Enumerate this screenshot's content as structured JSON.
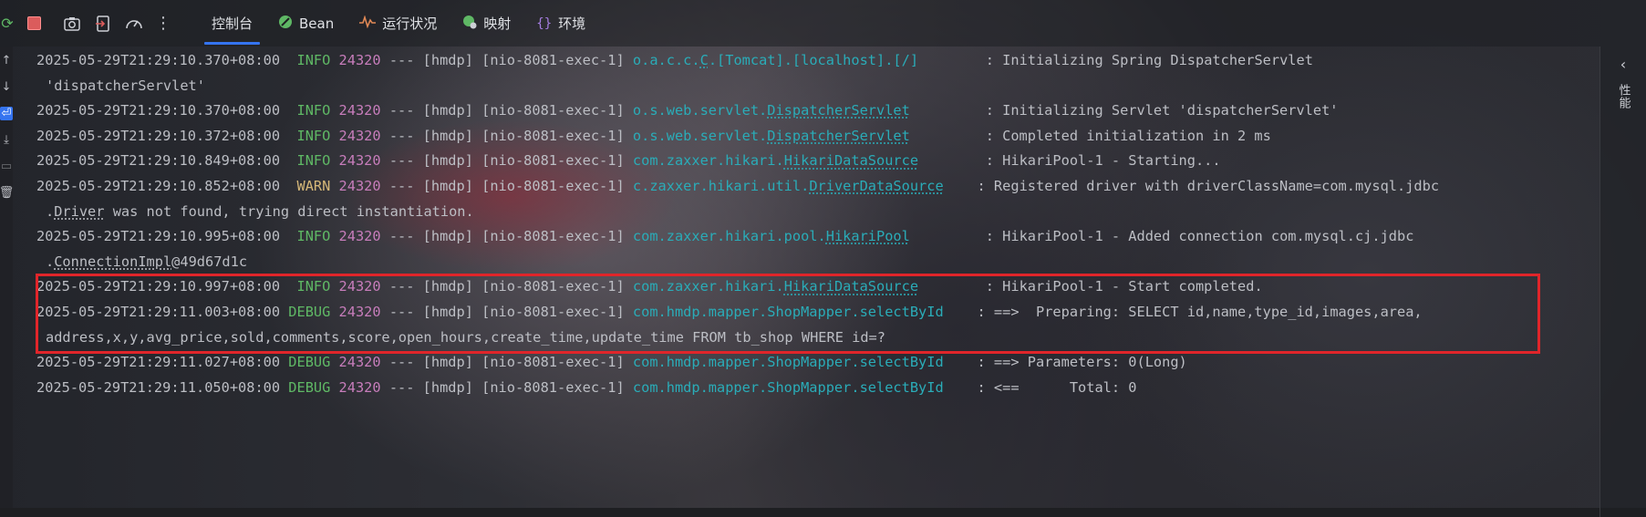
{
  "toolbar": {
    "icons": [
      "rerun-icon",
      "stop-icon",
      "screenshot-icon",
      "exit-icon",
      "dashboard-icon",
      "more-icon"
    ]
  },
  "tabs": [
    {
      "label": "控制台",
      "icon": "console-icon"
    },
    {
      "label": "Bean",
      "icon": "bean-icon"
    },
    {
      "label": "运行状况",
      "icon": "health-icon"
    },
    {
      "label": "映射",
      "icon": "mapping-icon"
    },
    {
      "label": "环境",
      "icon": "environment-icon"
    }
  ],
  "right_panel": {
    "label": "性能"
  },
  "log": [
    {
      "ts": "2025-05-29T21:29:10.370+08:00",
      "level": "INFO",
      "pid": "24320",
      "mid": " --- [hmdp] [nio-8081-exec-1] ",
      "logger_pre": "o.a.c.c.",
      "logger_link": "C",
      "logger_post": ".[Tomcat].[localhost].[/]",
      "pad": "        ",
      "msg": ": Initializing Spring DispatcherServlet",
      "cont": "'dispatcherServlet'"
    },
    {
      "ts": "2025-05-29T21:29:10.370+08:00",
      "level": "INFO",
      "pid": "24320",
      "mid": " --- [hmdp] [nio-8081-exec-1] ",
      "logger_pre": "o.s.web.servlet.",
      "logger_link": "DispatcherServlet",
      "logger_post": "",
      "pad": "         ",
      "msg": ": Initializing Servlet 'dispatcherServlet'"
    },
    {
      "ts": "2025-05-29T21:29:10.372+08:00",
      "level": "INFO",
      "pid": "24320",
      "mid": " --- [hmdp] [nio-8081-exec-1] ",
      "logger_pre": "o.s.web.servlet.",
      "logger_link": "DispatcherServlet",
      "logger_post": "",
      "pad": "         ",
      "msg": ": Completed initialization in 2 ms"
    },
    {
      "ts": "2025-05-29T21:29:10.849+08:00",
      "level": "INFO",
      "pid": "24320",
      "mid": " --- [hmdp] [nio-8081-exec-1] ",
      "logger_pre": "com.zaxxer.hikari.",
      "logger_link": "HikariDataSource",
      "logger_post": "",
      "pad": "        ",
      "msg": ": HikariPool-1 - Starting..."
    },
    {
      "ts": "2025-05-29T21:29:10.852+08:00",
      "level": "WARN",
      "pid": "24320",
      "mid": " --- [hmdp] [nio-8081-exec-1] ",
      "logger_pre": "c.zaxxer.hikari.util.",
      "logger_link": "DriverDataSource",
      "logger_post": "",
      "pad": "    ",
      "msg": ": Registered driver with driverClassName=com.mysql.jdbc",
      "cont_pre": ".",
      "cont_link": "Driver",
      "cont_post": " was not found, trying direct instantiation."
    },
    {
      "ts": "2025-05-29T21:29:10.995+08:00",
      "level": "INFO",
      "pid": "24320",
      "mid": " --- [hmdp] [nio-8081-exec-1] ",
      "logger_pre": "com.zaxxer.hikari.pool.",
      "logger_link": "HikariPool",
      "logger_post": "",
      "pad": "         ",
      "msg": ": HikariPool-1 - Added connection com.mysql.cj.jdbc",
      "cont_pre": ".",
      "cont_link": "ConnectionImpl",
      "cont_post": "@49d67d1c"
    },
    {
      "ts": "2025-05-29T21:29:10.997+08:00",
      "level": "INFO",
      "pid": "24320",
      "mid": " --- [hmdp] [nio-8081-exec-1] ",
      "logger_pre": "com.zaxxer.hikari.",
      "logger_link": "HikariDataSource",
      "logger_post": "",
      "pad": "        ",
      "msg": ": HikariPool-1 - Start completed."
    },
    {
      "ts": "2025-05-29T21:29:11.003+08:00",
      "level": "DEBUG",
      "pid": "24320",
      "mid": " --- [hmdp] [nio-8081-exec-1] ",
      "logger_pre": "com.hmdp.mapper.ShopMapper.selectById",
      "logger_link": "",
      "logger_post": "",
      "pad": "    ",
      "msg": ": ==>  Preparing: SELECT id,name,type_id,images,area,",
      "cont": "address,x,y,avg_price,sold,comments,score,open_hours,create_time,update_time FROM tb_shop WHERE id=?"
    },
    {
      "ts": "2025-05-29T21:29:11.027+08:00",
      "level": "DEBUG",
      "pid": "24320",
      "mid": " --- [hmdp] [nio-8081-exec-1] ",
      "logger_pre": "com.hmdp.mapper.ShopMapper.selectById",
      "logger_link": "",
      "logger_post": "",
      "pad": "    ",
      "msg": ": ==> Parameters: 0(Long)"
    },
    {
      "ts": "2025-05-29T21:29:11.050+08:00",
      "level": "DEBUG",
      "pid": "24320",
      "mid": " --- [hmdp] [nio-8081-exec-1] ",
      "logger_pre": "com.hmdp.mapper.ShopMapper.selectById",
      "logger_link": "",
      "logger_post": "",
      "pad": "    ",
      "msg": ": <==      Total: 0"
    }
  ],
  "colors": {
    "highlight": "#e0252a",
    "info": "#5fb865",
    "warn": "#d5b778",
    "pid": "#c77dbb",
    "logger": "#2aacb8",
    "accent": "#3574f0"
  }
}
